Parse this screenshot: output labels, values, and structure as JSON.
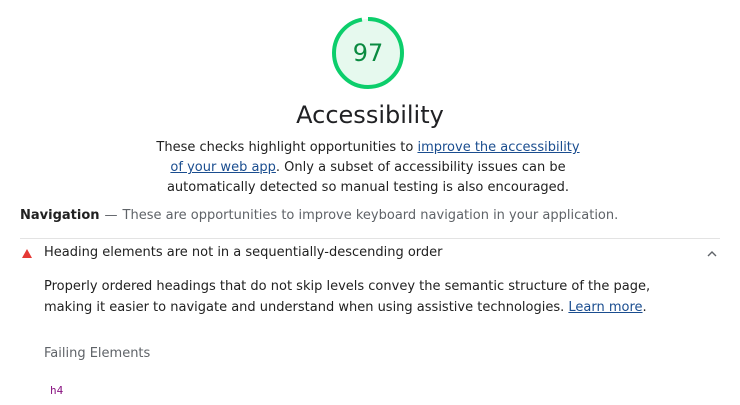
{
  "gauge": {
    "score": "97",
    "fraction": 0.97,
    "color": "#0cce6b",
    "bg_color": "#e6f9ee",
    "text_color": "#0a8a40"
  },
  "category": {
    "title": "Accessibility",
    "desc_before": "These checks highlight opportunities to ",
    "desc_link": "improve the accessibility of your web app",
    "desc_after": ". Only a subset of accessibility issues can be automatically detected so manual testing is also encouraged."
  },
  "group": {
    "title": "Navigation",
    "separator": "—",
    "description": "These are opportunities to improve keyboard navigation in your application."
  },
  "audit": {
    "status_icon": "warning-triangle-icon",
    "status_color": "#e53935",
    "title": "Heading elements are not in a sequentially-descending order",
    "expanded": true,
    "expand_icon": "chevron-up-icon",
    "desc_text": "Properly ordered headings that do not skip levels convey the semantic structure of the page, making it easier to navigate and understand when using assistive technologies. ",
    "learn_more": "Learn more",
    "desc_end": ".",
    "failing_label": "Failing Elements",
    "failing_nodes": [
      "h4"
    ]
  }
}
